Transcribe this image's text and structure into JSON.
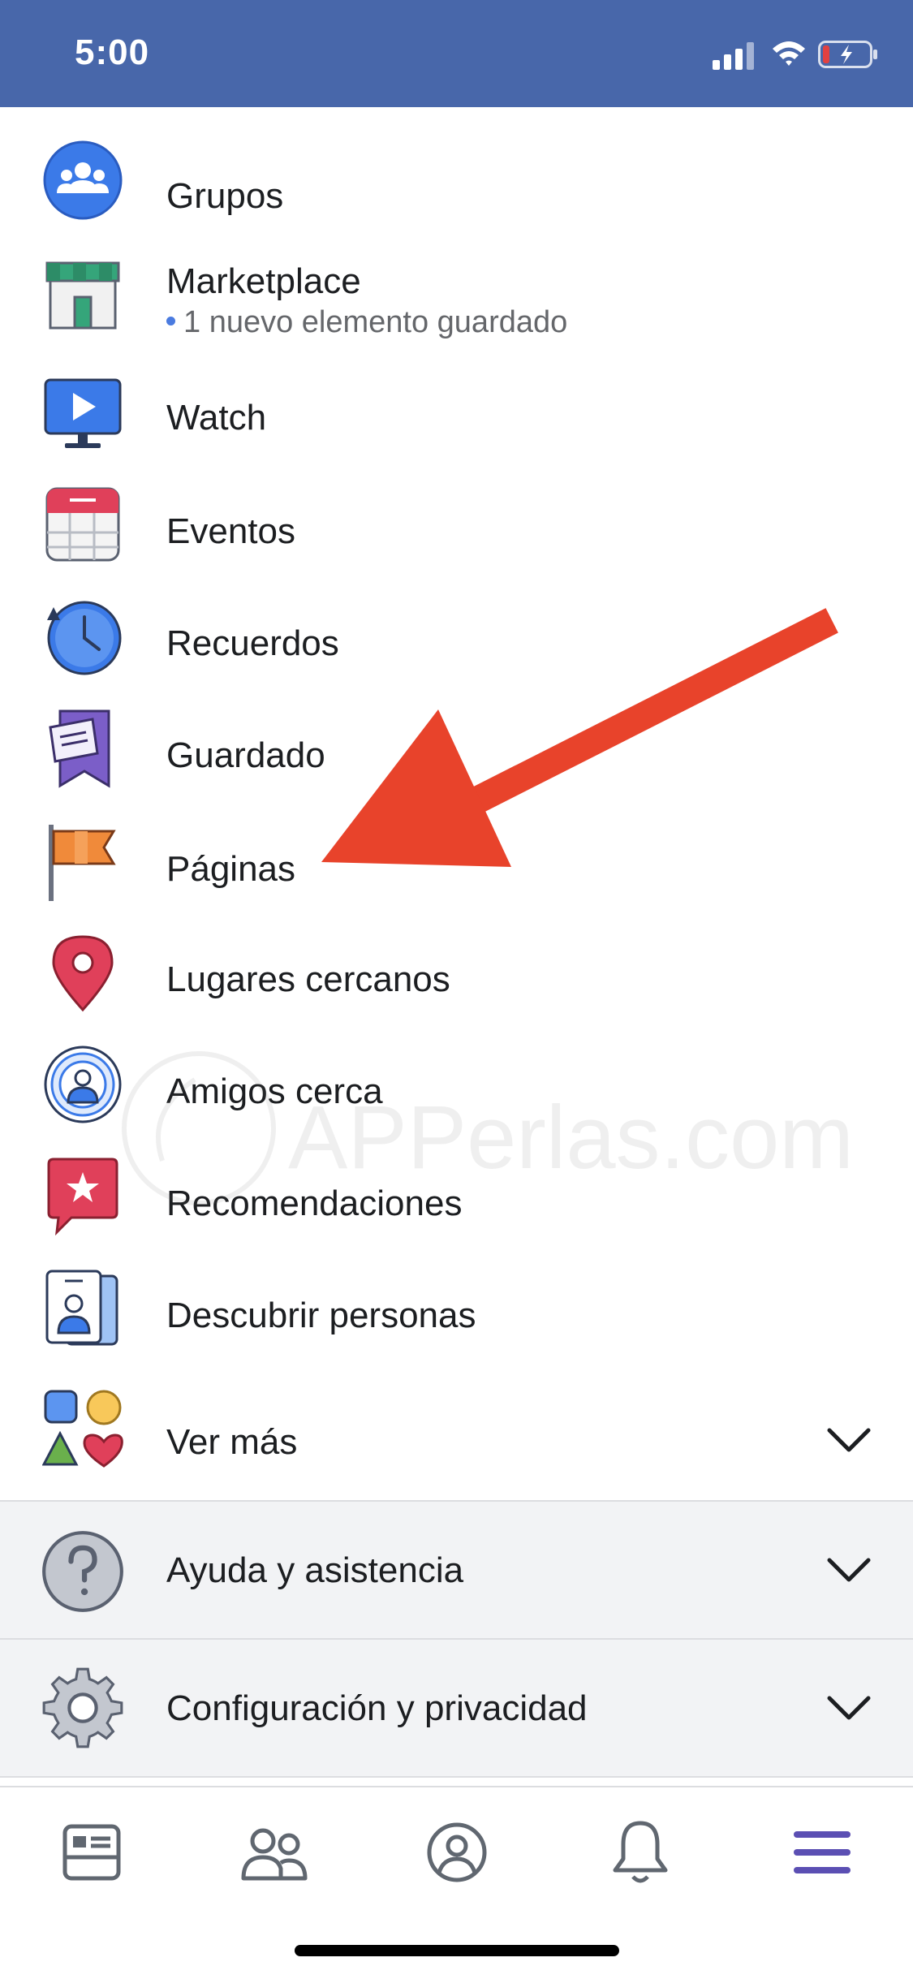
{
  "status_bar": {
    "time": "5:00"
  },
  "menu": {
    "items": [
      {
        "label": "Grupos",
        "icon": "groups-icon"
      },
      {
        "label": "Marketplace",
        "sub": "1 nuevo elemento guardado",
        "icon": "marketplace-icon"
      },
      {
        "label": "Watch",
        "icon": "watch-icon"
      },
      {
        "label": "Eventos",
        "icon": "calendar-icon"
      },
      {
        "label": "Recuerdos",
        "icon": "memories-clock-icon"
      },
      {
        "label": "Guardado",
        "icon": "saved-bookmark-icon"
      },
      {
        "label": "Páginas",
        "icon": "pages-flag-icon"
      },
      {
        "label": "Lugares cercanos",
        "icon": "location-pin-icon"
      },
      {
        "label": "Amigos cerca",
        "icon": "nearby-friends-icon"
      },
      {
        "label": "Recomendaciones",
        "icon": "recommendations-star-icon"
      },
      {
        "label": "Descubrir personas",
        "icon": "discover-people-icon"
      },
      {
        "label": "Ver más",
        "icon": "shapes-icon"
      }
    ],
    "sections": [
      {
        "label": "Ayuda y asistencia",
        "icon": "help-icon"
      },
      {
        "label": "Configuración y privacidad",
        "icon": "gear-icon"
      }
    ]
  },
  "watermark": {
    "text": "APPerlas.com"
  },
  "tab_bar": {
    "tabs": [
      "news-feed-icon",
      "friends-icon",
      "profile-icon",
      "notifications-bell-icon",
      "menu-hamburger-icon"
    ],
    "active_color": "#5b4fb3"
  },
  "colors": {
    "header": "#4867aa",
    "arrow": "#e8432b",
    "dot": "#4a7be0"
  }
}
